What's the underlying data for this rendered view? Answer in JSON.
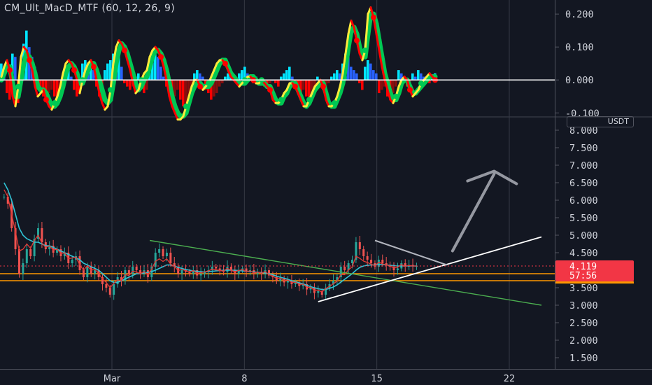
{
  "indicator": {
    "title": "CM_Ult_MacD_MTF (60, 12, 26, 9)"
  },
  "currency": "USDT",
  "price_badge": {
    "value": "4.119",
    "countdown": "57:56",
    "color": "#f23645"
  },
  "colors": {
    "background": "#131722",
    "macd_up_strong": "#00e5ff",
    "macd_up": "#2962ff",
    "macd_down_strong": "#ff0000",
    "macd_down": "#880e0e",
    "signal_up": "#00c853",
    "signal_down": "#ffeb3b",
    "candle_up": "#26a69a",
    "candle_down": "#ef5350",
    "ma": "#2ec4d6",
    "ma2": "#e53935",
    "support": "#ff9800",
    "trend_green": "#4caf50",
    "trend_white": "#ffffff",
    "projection_arrow": "#9598a1"
  },
  "chart_data": [
    {
      "type": "bar",
      "name_shown": "CM_Ult_MacD_MTF (60, 12, 26, 9)",
      "ylim": [
        -0.11,
        0.23
      ],
      "yticks": [
        "0.200",
        "0.100",
        "0.000",
        "-0.100"
      ],
      "ytick_values": [
        0.2,
        0.1,
        0,
        -0.1
      ],
      "x": [
        0,
        4,
        8,
        12,
        16,
        20,
        24,
        28,
        32,
        36,
        40,
        44,
        48,
        52,
        56,
        60,
        64,
        68,
        72,
        76,
        80,
        84,
        88,
        92,
        96,
        100,
        104,
        108,
        112,
        116,
        120,
        124,
        128,
        132,
        136,
        140,
        144,
        148,
        152,
        156,
        160,
        164,
        168,
        172,
        176,
        180,
        184,
        188,
        192,
        196,
        200,
        204,
        208,
        212,
        216,
        220,
        224,
        228,
        232,
        236,
        240,
        244,
        248,
        252,
        256,
        260,
        264,
        268,
        272,
        276,
        280,
        284,
        288,
        292,
        296,
        300,
        304,
        308,
        312,
        316,
        320,
        324,
        328,
        332,
        336,
        340,
        344,
        348,
        352,
        356,
        360,
        364,
        368,
        372,
        376,
        380,
        384,
        388,
        392,
        396,
        400,
        404,
        408,
        412,
        416,
        420,
        424,
        428,
        432,
        436,
        440,
        444,
        448,
        452,
        456,
        460,
        464,
        468,
        472,
        476,
        480,
        484,
        488,
        492,
        496,
        500,
        504,
        508,
        512,
        516,
        520,
        524,
        528,
        532,
        536,
        540,
        544,
        548,
        552,
        556,
        560,
        564,
        568,
        572,
        576,
        580,
        584,
        588,
        592,
        596,
        600,
        604,
        608,
        612,
        616,
        620,
        624
      ],
      "histogram": [
        0.05,
        0.03,
        -0.04,
        -0.06,
        0.08,
        0.07,
        -0.07,
        -0.03,
        0.11,
        0.15,
        0.1,
        0.07,
        0.04,
        -0.02,
        -0.03,
        -0.05,
        -0.06,
        -0.04,
        -0.03,
        -0.05,
        -0.07,
        -0.06,
        -0.02,
        0.02,
        0.03,
        0.01,
        -0.03,
        -0.05,
        -0.04,
        0.05,
        0.06,
        0.02,
        0.06,
        0.03,
        -0.02,
        -0.05,
        -0.06,
        0.03,
        0.05,
        0.06,
        0.08,
        0.07,
        0.08,
        0.04,
        -0.01,
        -0.02,
        -0.03,
        -0.02,
        0.01,
        0.02,
        -0.02,
        -0.04,
        -0.03,
        0.06,
        0.08,
        0.09,
        0.07,
        0.04,
        0.01,
        -0.02,
        -0.04,
        -0.06,
        -0.05,
        -0.03,
        -0.06,
        -0.08,
        -0.07,
        -0.05,
        -0.03,
        0.02,
        0.03,
        0.02,
        0.01,
        -0.03,
        -0.04,
        -0.06,
        -0.05,
        -0.04,
        -0.02,
        -0.01,
        0.01,
        0.02,
        0.03,
        0.01,
        0.0,
        0.02,
        0.03,
        0.04,
        0.02,
        0.01,
        -0.01,
        0.01,
        0.0,
        -0.01,
        -0.02,
        -0.02,
        -0.01,
        0.0,
        -0.01,
        -0.02,
        0.01,
        0.02,
        0.03,
        0.04,
        0.01,
        -0.02,
        -0.03,
        -0.04,
        -0.03,
        -0.05,
        -0.06,
        -0.04,
        -0.02,
        0.01,
        -0.02,
        -0.03,
        -0.02,
        -0.01,
        0.01,
        0.02,
        0.03,
        0.02,
        0.05,
        0.08,
        0.07,
        0.04,
        0.03,
        0.02,
        -0.01,
        -0.03,
        0.04,
        0.06,
        0.05,
        0.03,
        0.02,
        -0.04,
        -0.03,
        -0.02,
        -0.05,
        -0.06,
        -0.04,
        -0.02,
        0.03,
        0.02,
        0.01,
        -0.02,
        -0.01,
        0.02,
        0.01,
        0.03,
        0.02,
        0.01,
        0.0,
        -0.01,
        0.01,
        0.02
      ],
      "macd": [
        0.01,
        0.04,
        0.06,
        0.03,
        -0.05,
        -0.08,
        -0.02,
        0.07,
        0.1,
        0.09,
        0.06,
        0.03,
        -0.02,
        -0.05,
        -0.04,
        -0.03,
        -0.06,
        -0.08,
        -0.09,
        -0.07,
        -0.05,
        -0.02,
        0.02,
        0.05,
        0.06,
        0.05,
        0.03,
        0.0,
        -0.04,
        0.0,
        0.03,
        0.05,
        0.06,
        0.04,
        0.0,
        -0.04,
        -0.07,
        -0.09,
        -0.08,
        -0.03,
        0.05,
        0.1,
        0.12,
        0.11,
        0.09,
        0.06,
        0.03,
        -0.01,
        -0.04,
        -0.03,
        0.0,
        0.02,
        0.03,
        0.07,
        0.09,
        0.1,
        0.09,
        0.07,
        0.04,
        0.0,
        -0.05,
        -0.08,
        -0.1,
        -0.12,
        -0.12,
        -0.11,
        -0.08,
        -0.05,
        -0.02,
        0.0,
        0.0,
        -0.02,
        -0.03,
        -0.02,
        -0.01,
        0.01,
        0.03,
        0.05,
        0.06,
        0.06,
        0.05,
        0.03,
        0.01,
        0.0,
        -0.01,
        -0.02,
        -0.01,
        0.0,
        0.01,
        0.01,
        0.0,
        -0.01,
        -0.01,
        0.0,
        -0.01,
        -0.02,
        -0.03,
        -0.06,
        -0.07,
        -0.07,
        -0.06,
        -0.04,
        -0.03,
        -0.01,
        -0.01,
        -0.02,
        -0.04,
        -0.06,
        -0.08,
        -0.08,
        -0.06,
        -0.04,
        -0.02,
        -0.01,
        0.0,
        -0.02,
        -0.06,
        -0.08,
        -0.08,
        -0.07,
        -0.05,
        -0.02,
        0.02,
        0.08,
        0.14,
        0.18,
        0.16,
        0.12,
        0.08,
        0.06,
        0.09,
        0.2,
        0.22,
        0.19,
        0.14,
        0.09,
        0.04,
        0.0,
        -0.03,
        -0.06,
        -0.07,
        -0.05,
        -0.02,
        0.0,
        0.01,
        0.0,
        -0.03,
        -0.05,
        -0.04,
        -0.03,
        -0.01,
        0.0,
        0.01,
        0.02,
        0.01,
        0.0
      ],
      "signal": [
        0.0,
        0.02,
        0.04,
        0.04,
        -0.01,
        -0.05,
        -0.05,
        0.0,
        0.05,
        0.08,
        0.07,
        0.05,
        0.02,
        -0.02,
        -0.03,
        -0.03,
        -0.04,
        -0.06,
        -0.08,
        -0.08,
        -0.07,
        -0.05,
        -0.02,
        0.02,
        0.04,
        0.05,
        0.04,
        0.02,
        -0.01,
        -0.01,
        0.01,
        0.03,
        0.05,
        0.05,
        0.03,
        0.0,
        -0.03,
        -0.06,
        -0.07,
        -0.06,
        -0.01,
        0.05,
        0.09,
        0.11,
        0.1,
        0.08,
        0.05,
        0.02,
        -0.01,
        -0.03,
        -0.02,
        0.0,
        0.01,
        0.04,
        0.07,
        0.09,
        0.09,
        0.08,
        0.06,
        0.03,
        -0.01,
        -0.05,
        -0.08,
        -0.1,
        -0.11,
        -0.11,
        -0.1,
        -0.07,
        -0.04,
        -0.02,
        -0.01,
        -0.01,
        -0.02,
        -0.02,
        -0.02,
        -0.01,
        0.01,
        0.03,
        0.05,
        0.06,
        0.06,
        0.04,
        0.02,
        0.01,
        0.0,
        -0.01,
        -0.01,
        -0.01,
        0.0,
        0.01,
        0.01,
        0.0,
        -0.01,
        -0.01,
        -0.01,
        -0.02,
        -0.02,
        -0.04,
        -0.06,
        -0.07,
        -0.07,
        -0.05,
        -0.04,
        -0.02,
        -0.01,
        -0.01,
        -0.03,
        -0.05,
        -0.07,
        -0.08,
        -0.07,
        -0.05,
        -0.03,
        -0.02,
        -0.01,
        -0.01,
        -0.04,
        -0.07,
        -0.08,
        -0.08,
        -0.06,
        -0.04,
        -0.01,
        0.04,
        0.1,
        0.15,
        0.16,
        0.14,
        0.1,
        0.07,
        0.07,
        0.14,
        0.2,
        0.2,
        0.17,
        0.12,
        0.07,
        0.02,
        -0.01,
        -0.04,
        -0.06,
        -0.06,
        -0.04,
        -0.01,
        0.0,
        0.0,
        -0.02,
        -0.04,
        -0.04,
        -0.03,
        -0.02,
        -0.01,
        0.0,
        0.01,
        0.01,
        0.01
      ]
    },
    {
      "type": "line",
      "ylim": [
        1.5,
        8.0
      ],
      "yticks": [
        "8.000",
        "7.500",
        "7.000",
        "6.500",
        "6.000",
        "5.500",
        "5.000",
        "4.500",
        "4.000",
        "3.500",
        "3.000",
        "2.500",
        "2.000",
        "1.500"
      ],
      "ytick_values": [
        8,
        7.5,
        7,
        6.5,
        6,
        5.5,
        5,
        4.5,
        4,
        3.5,
        3,
        2.5,
        2,
        1.5
      ],
      "xticks": [
        "Mar",
        "8",
        "15",
        "22"
      ],
      "xtick_values": [
        1,
        8,
        15,
        22
      ],
      "xlim": [
        -4.7,
        23.7
      ],
      "x": [
        -4.7,
        -4.5,
        -4.3,
        -4.1,
        -3.9,
        -3.7,
        -3.5,
        -3.3,
        -3.1,
        -2.9,
        -2.7,
        -2.5,
        -2.3,
        -2.1,
        -1.9,
        -1.7,
        -1.5,
        -1.3,
        -1.1,
        -0.9,
        -0.7,
        -0.5,
        -0.3,
        -0.1,
        0.1,
        0.3,
        0.5,
        0.7,
        0.9,
        1.1,
        1.3,
        1.5,
        1.7,
        1.9,
        2.1,
        2.3,
        2.5,
        2.7,
        2.9,
        3.1,
        3.3,
        3.5,
        3.7,
        3.9,
        4.1,
        4.3,
        4.5,
        4.7,
        4.9,
        5.1,
        5.3,
        5.5,
        5.7,
        5.9,
        6.1,
        6.3,
        6.5,
        6.7,
        6.9,
        7.1,
        7.3,
        7.5,
        7.7,
        7.9,
        8.1,
        8.3,
        8.5,
        8.7,
        8.9,
        9.1,
        9.3,
        9.5,
        9.7,
        9.9,
        10.1,
        10.3,
        10.5,
        10.7,
        10.9,
        11.1,
        11.3,
        11.5,
        11.7,
        11.9,
        12.1,
        12.3,
        12.5,
        12.7,
        12.9,
        13.1,
        13.3,
        13.5,
        13.7,
        13.9,
        14.1,
        14.3,
        14.5,
        14.7,
        14.9,
        15.1,
        15.3,
        15.5,
        15.7,
        15.9,
        16.1,
        16.3,
        16.5,
        16.7,
        16.9,
        17.1,
        17.3,
        17.5,
        17.7,
        17.9
      ],
      "close": [
        6.1,
        5.9,
        5.2,
        4.6,
        3.9,
        4.2,
        4.6,
        4.4,
        4.9,
        5.2,
        4.8,
        4.6,
        4.7,
        4.5,
        4.6,
        4.4,
        4.5,
        4.2,
        4.3,
        4.4,
        4.0,
        3.8,
        4.1,
        3.9,
        4.0,
        3.8,
        3.6,
        3.5,
        3.3,
        3.6,
        3.8,
        3.7,
        4.0,
        3.9,
        4.1,
        4.0,
        3.9,
        4.0,
        3.8,
        4.1,
        4.5,
        4.6,
        4.4,
        4.5,
        4.2,
        4.1,
        3.9,
        4.0,
        3.95,
        3.9,
        4.0,
        3.85,
        3.9,
        3.95,
        4.0,
        4.1,
        4.05,
        4.0,
        3.95,
        4.1,
        4.0,
        3.9,
        4.0,
        4.05,
        3.95,
        4.0,
        3.9,
        3.95,
        3.9,
        4.0,
        3.85,
        3.8,
        3.7,
        3.75,
        3.65,
        3.7,
        3.6,
        3.65,
        3.55,
        3.6,
        3.45,
        3.5,
        3.35,
        3.4,
        3.3,
        3.5,
        3.6,
        3.7,
        3.8,
        4.1,
        4.0,
        4.2,
        4.3,
        4.8,
        4.6,
        4.4,
        4.3,
        4.2,
        4.1,
        4.3,
        4.2,
        4.15,
        4.1,
        4.0,
        4.05,
        4.2,
        4.1,
        4.15,
        4.119,
        4.119
      ],
      "ma": [
        6.5,
        6.3,
        6.0,
        5.6,
        5.2,
        5.0,
        4.9,
        4.85,
        4.8,
        4.8,
        4.75,
        4.7,
        4.7,
        4.65,
        4.6,
        4.55,
        4.5,
        4.45,
        4.4,
        4.35,
        4.3,
        4.2,
        4.15,
        4.1,
        4.05,
        4.0,
        3.9,
        3.8,
        3.7,
        3.65,
        3.65,
        3.7,
        3.75,
        3.8,
        3.85,
        3.9,
        3.9,
        3.92,
        3.94,
        3.96,
        4.0,
        4.05,
        4.1,
        4.15,
        4.15,
        4.12,
        4.08,
        4.05,
        4.02,
        4.0,
        3.98,
        3.97,
        3.96,
        3.95,
        3.96,
        3.97,
        3.98,
        3.99,
        4.0,
        4.0,
        4.0,
        4.0,
        3.99,
        3.98,
        3.97,
        3.96,
        3.95,
        3.94,
        3.93,
        3.92,
        3.9,
        3.87,
        3.83,
        3.8,
        3.77,
        3.74,
        3.7,
        3.67,
        3.64,
        3.61,
        3.57,
        3.53,
        3.5,
        3.47,
        3.45,
        3.45,
        3.48,
        3.52,
        3.58,
        3.66,
        3.74,
        3.82,
        3.9,
        4.0,
        4.08,
        4.12,
        4.14,
        4.15,
        4.15,
        4.16,
        4.16,
        4.15,
        4.14,
        4.13,
        4.12,
        4.12,
        4.12,
        4.12,
        4.12,
        4.12
      ],
      "lines": [
        {
          "x": [
            3.0,
            23.7
          ],
          "y": [
            4.85,
            3.0
          ]
        },
        {
          "x": [
            11.9,
            23.7
          ],
          "y": [
            3.1,
            4.95
          ]
        },
        {
          "x": [
            14.9,
            18.7
          ],
          "y": [
            4.85,
            4.15
          ]
        },
        {
          "x": [
            -4.7,
            23.7
          ],
          "y": [
            3.9,
            3.9
          ]
        },
        {
          "x": [
            -4.7,
            23.7
          ],
          "y": [
            3.7,
            3.7
          ]
        }
      ],
      "projection_arrow": {
        "x": [
          19.0,
          21.2
        ],
        "y": [
          4.55,
          6.75
        ]
      }
    }
  ]
}
